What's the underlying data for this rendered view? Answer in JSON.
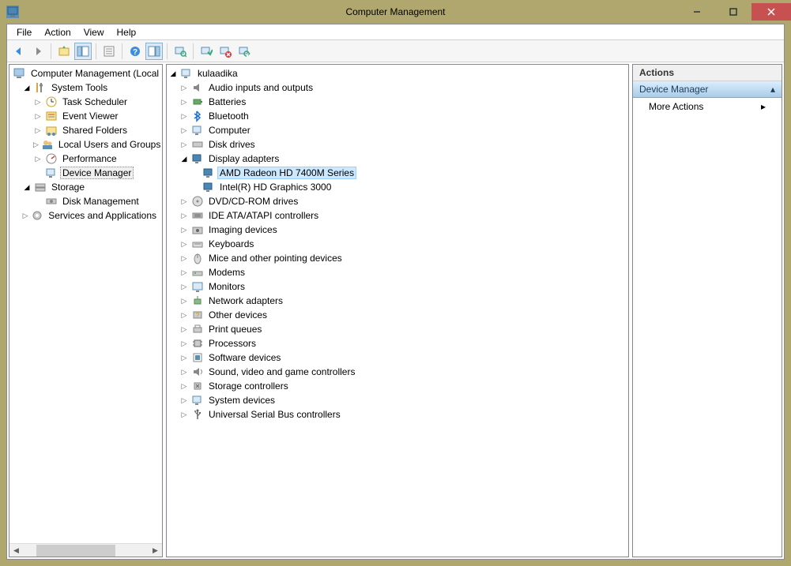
{
  "window": {
    "title": "Computer Management"
  },
  "menubar": [
    "File",
    "Action",
    "View",
    "Help"
  ],
  "left_tree": {
    "root": "Computer Management (Local",
    "system_tools": "System Tools",
    "system_tools_children": [
      "Task Scheduler",
      "Event Viewer",
      "Shared Folders",
      "Local Users and Groups",
      "Performance",
      "Device Manager"
    ],
    "storage": "Storage",
    "storage_children": [
      "Disk Management"
    ],
    "services": "Services and Applications"
  },
  "mid_tree": {
    "root": "kulaadika",
    "categories": [
      "Audio inputs and outputs",
      "Batteries",
      "Bluetooth",
      "Computer",
      "Disk drives",
      "Display adapters",
      "DVD/CD-ROM drives",
      "IDE ATA/ATAPI controllers",
      "Imaging devices",
      "Keyboards",
      "Mice and other pointing devices",
      "Modems",
      "Monitors",
      "Network adapters",
      "Other devices",
      "Print queues",
      "Processors",
      "Software devices",
      "Sound, video and game controllers",
      "Storage controllers",
      "System devices",
      "Universal Serial Bus controllers"
    ],
    "display_children": [
      "AMD Radeon HD 7400M Series",
      "Intel(R) HD Graphics 3000"
    ]
  },
  "actions": {
    "header": "Actions",
    "section": "Device Manager",
    "more": "More Actions"
  }
}
